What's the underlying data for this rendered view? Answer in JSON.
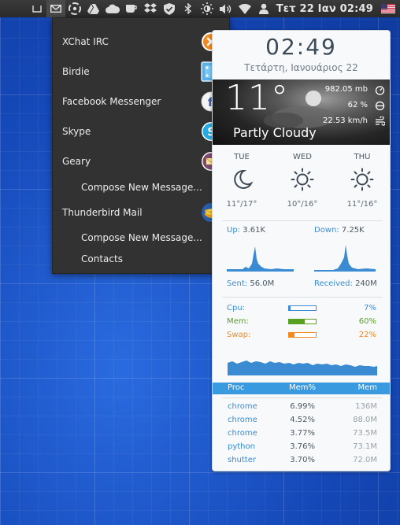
{
  "panel": {
    "clock": "Τετ 22 Ιαν 02:49",
    "tray_icons": [
      "window-icon",
      "mail-indicator-icon",
      "xchat-tray-icon",
      "drive-icon",
      "cloud-icon",
      "cup-icon",
      "dropbox-icon",
      "shield-icon",
      "bluetooth-icon",
      "brightness-icon",
      "volume-icon",
      "wifi-icon",
      "user-icon"
    ],
    "flag": "us-flag-icon"
  },
  "menu": {
    "items": [
      {
        "label": "XChat IRC",
        "icon": "xchat-app-icon",
        "type": "app"
      },
      {
        "label": "Birdie",
        "icon": "birdie-app-icon",
        "type": "app"
      },
      {
        "label": "Facebook Messenger",
        "icon": "facebook-app-icon",
        "type": "app"
      },
      {
        "label": "Skype",
        "icon": "skype-app-icon",
        "type": "app"
      },
      {
        "label": "Geary",
        "icon": "geary-app-icon",
        "type": "app"
      },
      {
        "label": "Compose New Message...",
        "type": "sub"
      },
      {
        "label": "Thunderbird Mail",
        "icon": "thunderbird-app-icon",
        "type": "app"
      },
      {
        "label": "Compose New Message...",
        "type": "sub"
      },
      {
        "label": "Contacts",
        "type": "sub"
      }
    ]
  },
  "conky": {
    "time": "02:49",
    "date": "Τετάρτη, Ιανουάριος 22",
    "weather": {
      "temp": "11°",
      "condition": "Partly Cloudy",
      "pressure": "982.05 mb",
      "humidity": "62 %",
      "wind": "22.53 km/h"
    },
    "forecast": [
      {
        "day": "TUE",
        "icon": "moon-icon",
        "range": "11°/17°"
      },
      {
        "day": "WED",
        "icon": "sun-icon",
        "range": "10°/16°"
      },
      {
        "day": "THU",
        "icon": "sun-icon",
        "range": "11°/16°"
      }
    ],
    "network": {
      "up_label": "Up:",
      "up": "3.61K",
      "down_label": "Down:",
      "down": "7.25K",
      "sent_label": "Sent:",
      "sent": "56.0M",
      "received_label": "Received:",
      "received": "240M"
    },
    "resources": [
      {
        "label": "Cpu:",
        "value": "7%",
        "fraction": 0.07,
        "color": "#3a8bd1"
      },
      {
        "label": "Mem:",
        "value": "60%",
        "fraction": 0.6,
        "color": "#5aa020"
      },
      {
        "label": "Swap:",
        "value": "22%",
        "fraction": 0.22,
        "color": "#f08a1e"
      }
    ],
    "proc_header": {
      "name": "Proc",
      "mempct": "Mem%",
      "mem": "Mem"
    },
    "processes": [
      {
        "name": "chrome",
        "mempct": "6.99%",
        "mem": "136M"
      },
      {
        "name": "chrome",
        "mempct": "4.52%",
        "mem": "88.0M"
      },
      {
        "name": "chrome",
        "mempct": "3.77%",
        "mem": "73.5M"
      },
      {
        "name": "python",
        "mempct": "3.76%",
        "mem": "73.1M"
      },
      {
        "name": "shutter",
        "mempct": "3.70%",
        "mem": "72.0M"
      }
    ]
  }
}
